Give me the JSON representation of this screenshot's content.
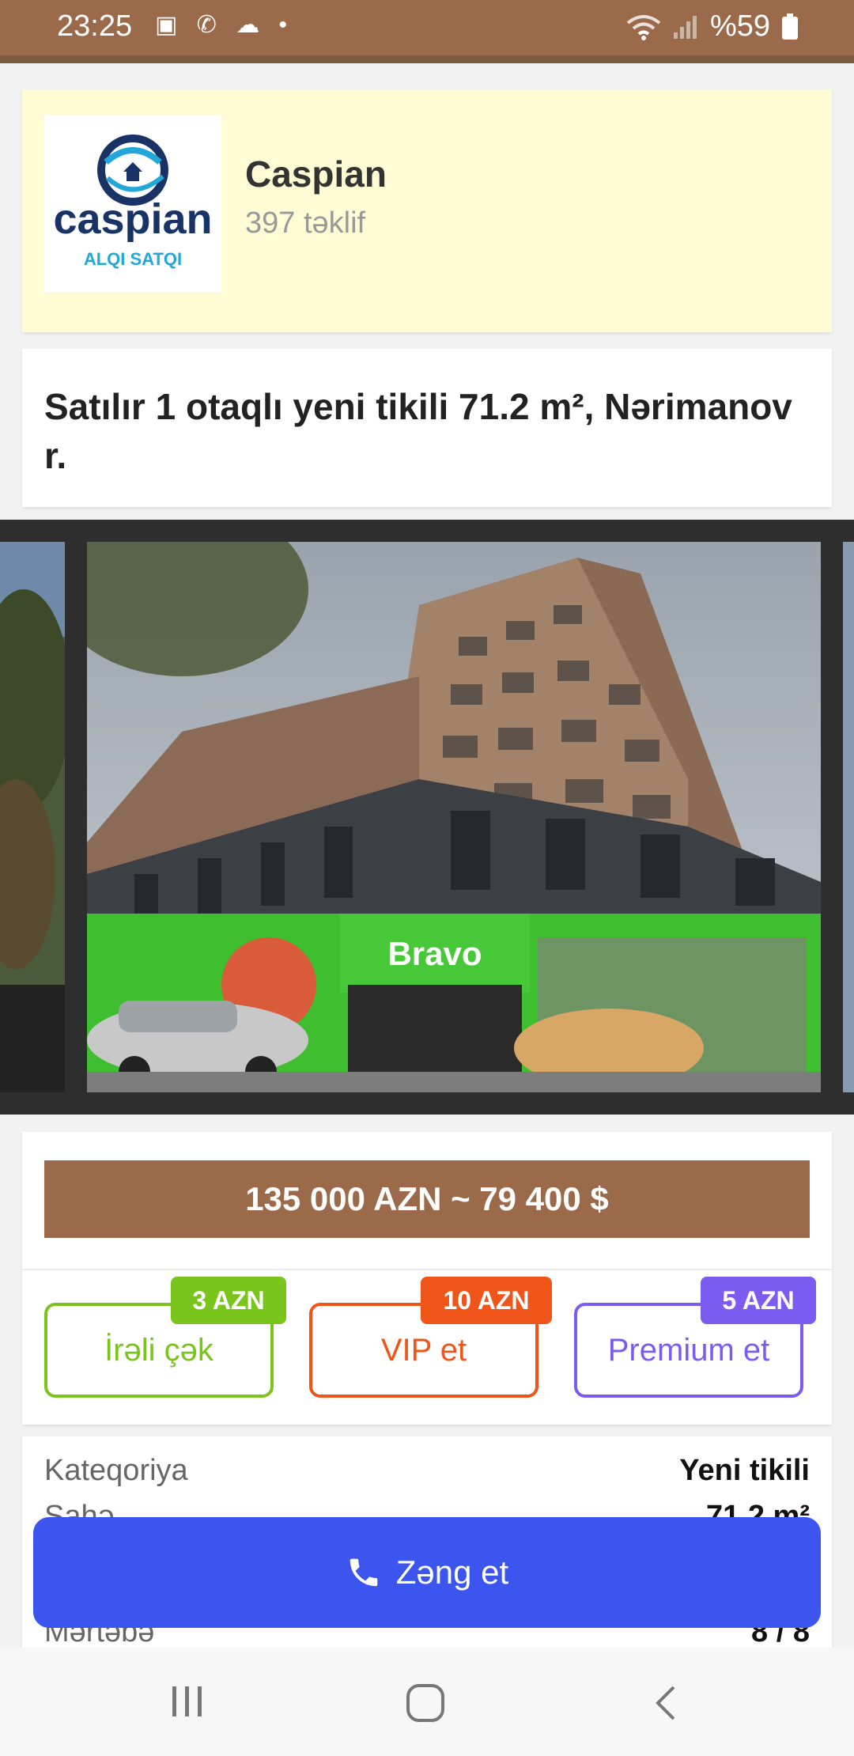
{
  "status_bar": {
    "time": "23:25",
    "battery": "%59",
    "left_icons": [
      "gallery-icon",
      "whatsapp-icon",
      "cloud-icon",
      "dot-icon"
    ],
    "right_icons": [
      "wifi-icon",
      "signal-icon",
      "battery-icon"
    ]
  },
  "agency": {
    "name": "Caspian",
    "offers": "397 təklif",
    "logo": {
      "brand": "caspian",
      "tagline": "ALQI SATQI"
    }
  },
  "listing": {
    "title": "Satılır 1 otaqlı yeni tikili 71.2 m², Nərimanov r.",
    "price": "135 000 AZN ~ 79 400 $"
  },
  "promotions": [
    {
      "label": "İrəli çək",
      "badge": "3 AZN",
      "color": "#79c51c"
    },
    {
      "label": "VIP et",
      "badge": "10 AZN",
      "color": "#ef5419"
    },
    {
      "label": "Premium et",
      "badge": "5 AZN",
      "color": "#7c5cf0"
    }
  ],
  "details": [
    {
      "key": "Kateqoriya",
      "value": "Yeni tikili"
    },
    {
      "key": "Sahə",
      "value": "71.2 m²"
    },
    {
      "key": "Mərtəbə",
      "value": "8 / 8"
    }
  ],
  "photo": {
    "storefront_sign": "Bravo"
  },
  "call_button": {
    "label": "Zəng et"
  },
  "colors": {
    "brand_brown": "#9a6a4a",
    "call_blue": "#3d55ef",
    "agency_bg": "#fffbd4"
  }
}
